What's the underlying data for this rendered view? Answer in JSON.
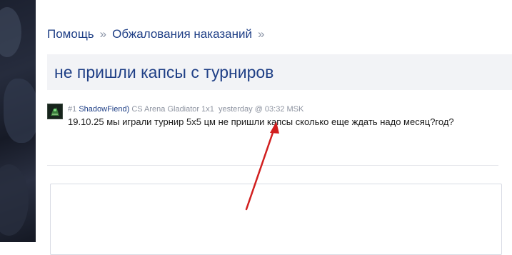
{
  "breadcrumb": {
    "items": [
      "Помощь",
      "Обжалования наказаний"
    ],
    "separator": "»"
  },
  "topic": {
    "title": "не пришли капсы с турниров"
  },
  "post": {
    "number": "#1",
    "author": "ShadowFiend)",
    "user_title": "CS Arena Gladiator 1x1",
    "timestamp": "yesterday @ 03:32 MSK",
    "body": "19.10.25 мы играли турнир 5x5 цм не пришли капсы сколько еще ждать надо месяц?год?"
  },
  "colors": {
    "link": "#1f3f86",
    "meta": "#8d93a0",
    "arrow": "#d11f1f",
    "title_bar_bg": "#f2f3f6"
  },
  "icons": {
    "avatar": "user-avatar-icon",
    "arrow": "red-annotation-arrow"
  }
}
